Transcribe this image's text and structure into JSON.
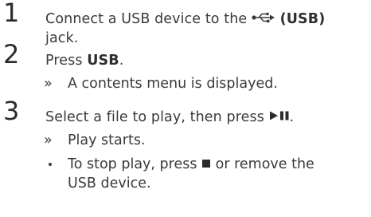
{
  "steps": [
    {
      "number": "1",
      "line1_prefix": "Connect a USB device to the",
      "line1_suffix": "(USB)",
      "line2": "jack.",
      "icon": "usb-icon"
    },
    {
      "number": "2",
      "text_prefix": "Press",
      "text_bold": "USB",
      "text_suffix": ".",
      "result_marker": "»",
      "result": "A contents menu is displayed."
    },
    {
      "number": "3",
      "text_prefix": "Select a file to play, then press",
      "text_suffix": ".",
      "icon": "play-pause-icon",
      "result_marker": "»",
      "result": "Play starts.",
      "note_line1_prefix": "To stop play, press",
      "note_line1_suffix": "or remove the",
      "note_line2": "USB device.",
      "note_icon": "stop-icon"
    }
  ]
}
